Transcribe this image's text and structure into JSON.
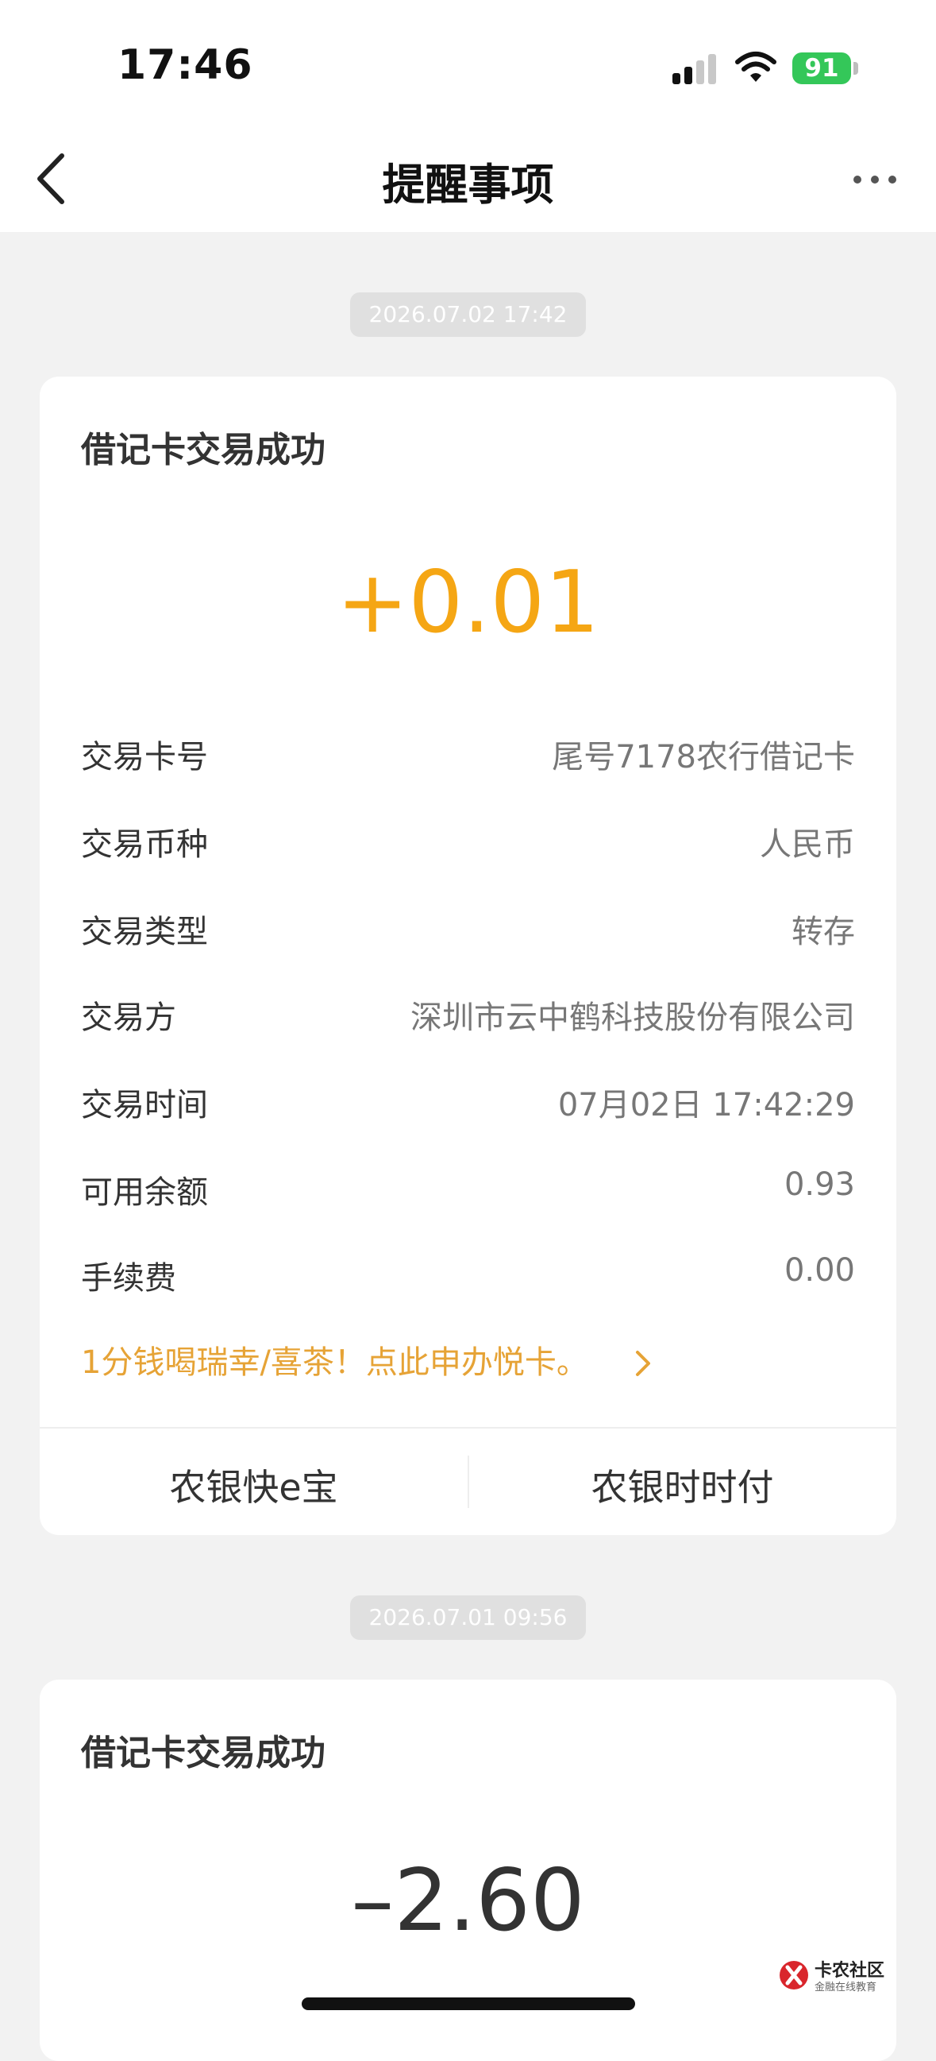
{
  "status_bar": {
    "time": "17:46",
    "battery": "91"
  },
  "nav": {
    "title": "提醒事项"
  },
  "messages": [
    {
      "timestamp": "2026.07.02 17:42",
      "title": "借记卡交易成功",
      "amount": "+0.01",
      "amount_color": "#f5a614",
      "rows": [
        {
          "label": "交易卡号",
          "value": "尾号7178农行借记卡"
        },
        {
          "label": "交易币种",
          "value": "人民币"
        },
        {
          "label": "交易类型",
          "value": "转存"
        },
        {
          "label": "交易方",
          "value": "深圳市云中鹤科技股份有限公司"
        },
        {
          "label": "交易时间",
          "value": "07月02日 17:42:29"
        },
        {
          "label": "可用余额",
          "value": "0.93"
        },
        {
          "label": "手续费",
          "value": "0.00"
        }
      ],
      "promo": "1分钱喝瑞幸/喜茶！点此申办悦卡。",
      "buttons": [
        "农银快e宝",
        "农银时时付"
      ]
    },
    {
      "timestamp": "2026.07.01 09:56",
      "title": "借记卡交易成功",
      "amount": "–2.60",
      "amount_color": "#333333"
    }
  ],
  "watermark": {
    "name": "卡农社区",
    "tagline": "金融在线教育"
  },
  "colors": {
    "accent": "#f5a614",
    "background": "#f2f2f2",
    "battery": "#34c759"
  }
}
